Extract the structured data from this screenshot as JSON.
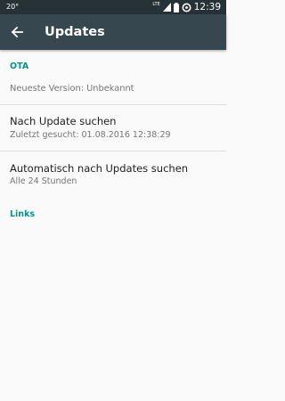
{
  "status_bar": {
    "temperature": "20°",
    "network_label": "LTE",
    "time": "12:39"
  },
  "toolbar": {
    "title": "Updates",
    "back_icon": "arrow-back-icon"
  },
  "sections": {
    "ota": {
      "header": "OTA",
      "latest_version": "Neueste Version: Unbekannt",
      "check_title": "Nach Update suchen",
      "check_summary": "Zuletzt gesucht: 01.08.2016 12:38:29",
      "auto_title": "Automatisch nach Updates suchen",
      "auto_summary": "Alle 24 Stunden"
    },
    "links": {
      "header": "Links"
    }
  },
  "colors": {
    "status_bar": "#263238",
    "app_bar": "#37474f",
    "accent": "#009688",
    "background": "#fafafa"
  }
}
